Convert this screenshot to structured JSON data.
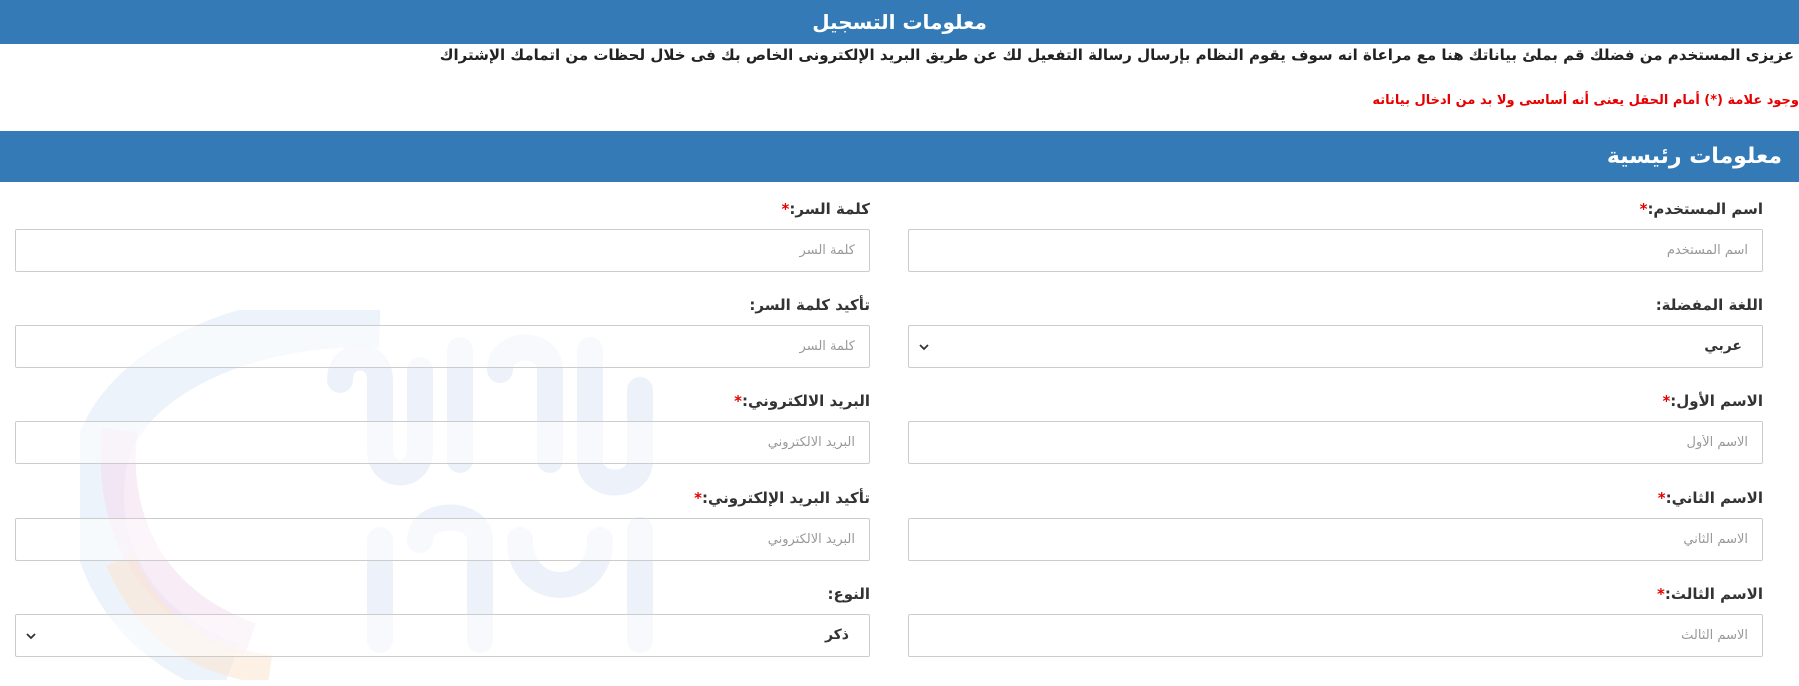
{
  "header": {
    "title": "معلومات التسجيل"
  },
  "intro": {
    "text": "عزيزى المستخدم من فضلك قم بملئ بياناتك هنا مع مراعاة انه سوف يقوم النظام بإرسال رسالة التفعيل لك عن طريق البريد الإلكترونى الخاص بك فى خلال لحظات من اتمامك الإشتراك",
    "required_note": "وجود علامة (*) أمام الحقل يعنى أنه أساسى ولا بد من ادخال بياناته"
  },
  "section": {
    "title": "معلومات رئيسية"
  },
  "required_mark": "*",
  "colors": {
    "bar": "#337ab7",
    "required": "#e60000"
  },
  "form": {
    "username": {
      "label": "اسم المستخدم:",
      "placeholder": "اسم المستخدم"
    },
    "password": {
      "label": "كلمة السر:",
      "placeholder": "كلمة السر"
    },
    "language": {
      "label": "اللغة المفضلة:",
      "value": "عربي"
    },
    "confirm_password": {
      "label": "تأكيد كلمة السر:",
      "placeholder": "كلمة السر"
    },
    "first_name": {
      "label": "الاسم الأول:",
      "placeholder": "الاسم الأول"
    },
    "email": {
      "label": "البريد الالكتروني:",
      "placeholder": "البريد الالكتروني"
    },
    "second_name": {
      "label": "الاسم الثاني:",
      "placeholder": "الاسم الثاني"
    },
    "confirm_email": {
      "label": "تأكيد البريد الإلكتروني:",
      "placeholder": "البريد الالكتروني"
    },
    "third_name": {
      "label": "الاسم الثالث:",
      "placeholder": "الاسم الثالث"
    },
    "gender": {
      "label": "النوع:",
      "value": "ذكر"
    }
  },
  "icons": {
    "select_arrow": "chevron-down-icon",
    "watermark": "site-logo-watermark"
  }
}
